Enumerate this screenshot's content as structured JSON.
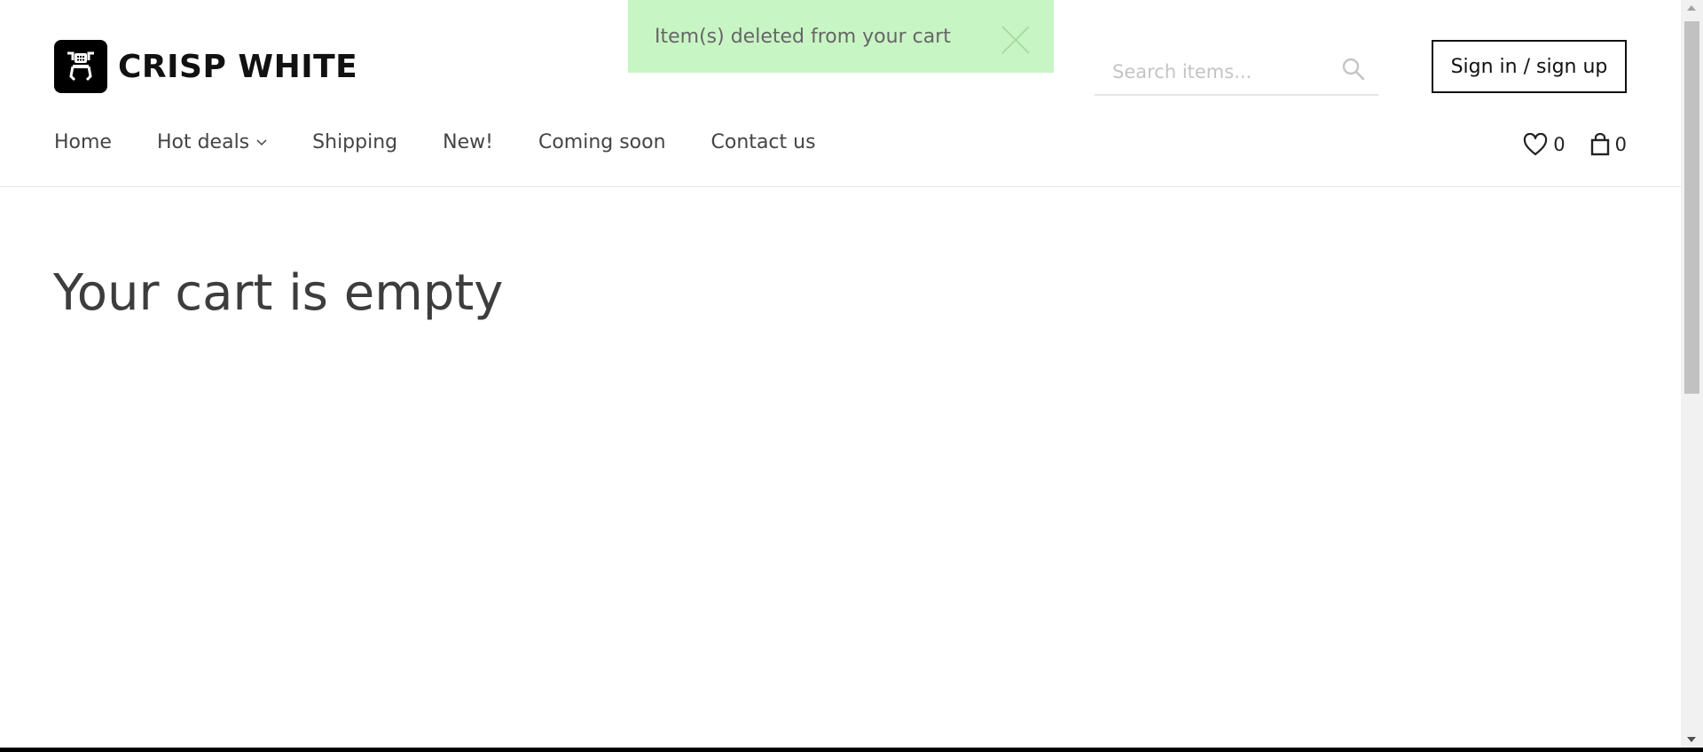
{
  "brand": {
    "name": "CRISP WHITE"
  },
  "toast": {
    "message": "Item(s) deleted from your cart",
    "background": "#c8f5c4"
  },
  "search": {
    "placeholder": "Search items..."
  },
  "auth": {
    "signin_label": "Sign in / sign up"
  },
  "nav": {
    "items": [
      {
        "label": "Home"
      },
      {
        "label": "Hot deals"
      },
      {
        "label": "Shipping"
      },
      {
        "label": "New!"
      },
      {
        "label": "Coming soon"
      },
      {
        "label": "Contact us"
      }
    ]
  },
  "counters": {
    "wishlist": "0",
    "cart": "0"
  },
  "main": {
    "title": "Your cart is empty"
  },
  "icons": {
    "logo": "robot-logo-icon",
    "close": "close-icon",
    "search": "search-icon",
    "dropdown": "chevron-down-icon",
    "wishlist": "heart-icon",
    "cart": "shopping-bag-icon"
  }
}
